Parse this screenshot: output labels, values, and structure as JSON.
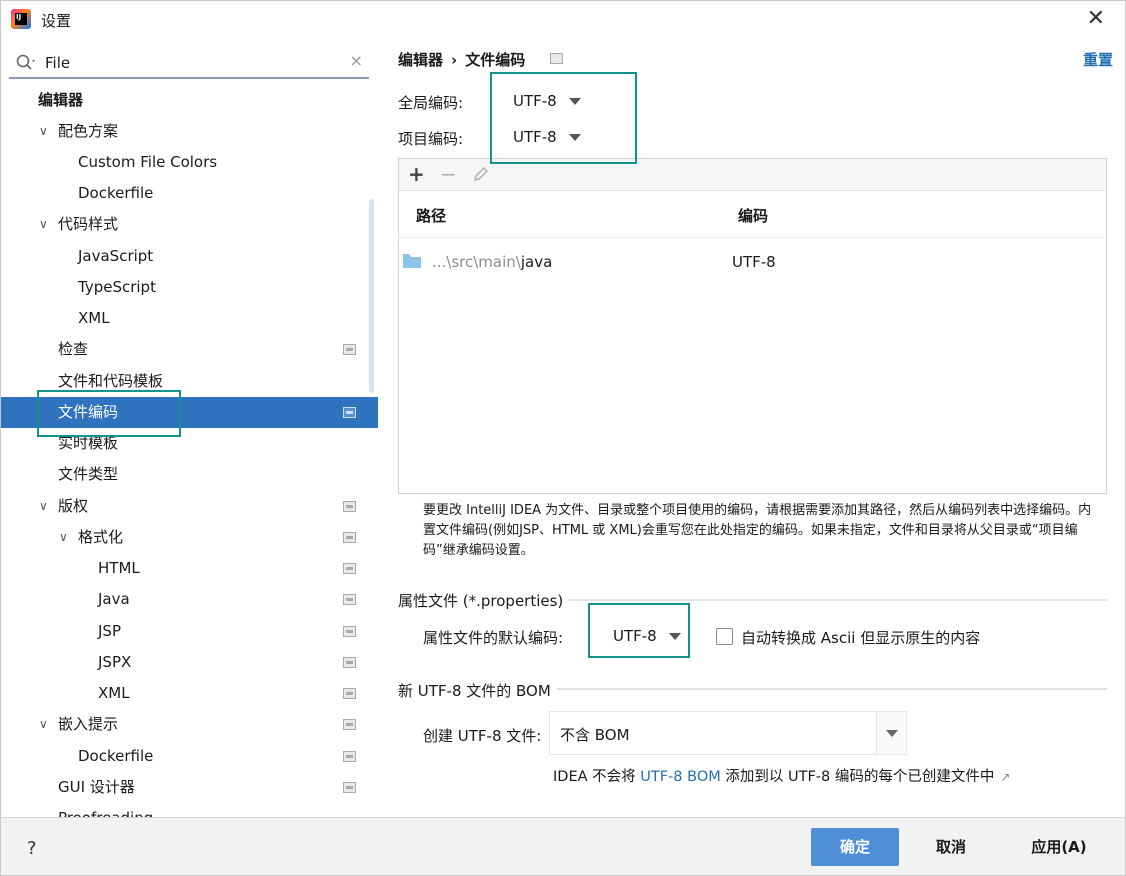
{
  "window": {
    "title": "设置",
    "close_glyph": "✕"
  },
  "search": {
    "value": "File",
    "clear_glyph": "×"
  },
  "tree": [
    {
      "label": "编辑器"
    },
    {
      "label": "配色方案",
      "chevron": "∨"
    },
    {
      "label": "Custom File Colors"
    },
    {
      "label": "Dockerfile"
    },
    {
      "label": "代码样式",
      "chevron": "∨"
    },
    {
      "label": "JavaScript"
    },
    {
      "label": "TypeScript"
    },
    {
      "label": "XML"
    },
    {
      "label": "检查"
    },
    {
      "label": "文件和代码模板"
    },
    {
      "label": "文件编码"
    },
    {
      "label": "实时模板"
    },
    {
      "label": "文件类型"
    },
    {
      "label": "版权",
      "chevron": "∨"
    },
    {
      "label": "格式化",
      "chevron": "∨"
    },
    {
      "label": "HTML"
    },
    {
      "label": "Java"
    },
    {
      "label": "JSP"
    },
    {
      "label": "JSPX"
    },
    {
      "label": "XML"
    },
    {
      "label": "嵌入提示",
      "chevron": "∨"
    },
    {
      "label": "Dockerfile"
    },
    {
      "label": "GUI 设计器"
    },
    {
      "label": "Proofreading"
    }
  ],
  "breadcrumb": {
    "parent": "编辑器",
    "sep": "›",
    "current": "文件编码"
  },
  "reset_label": "重置",
  "global_encoding": {
    "label": "全局编码:",
    "value": "UTF-8"
  },
  "project_encoding": {
    "label": "项目编码:",
    "value": "UTF-8"
  },
  "table": {
    "toolbar": {
      "add": "+",
      "remove": "−"
    },
    "headers": {
      "path": "路径",
      "encoding": "编码"
    },
    "rows": [
      {
        "path_prefix": "...\\src\\main\\",
        "path_leaf": "java",
        "encoding": "UTF-8"
      }
    ]
  },
  "hint": "要更改 IntelliJ IDEA 为文件、目录或整个项目使用的编码，请根据需要添加其路径，然后从编码列表中选择编码。内置文件编码(例如JSP、HTML 或 XML)会重写您在此处指定的编码。如果未指定，文件和目录将从父目录或“项目编码”继承编码设置。",
  "properties": {
    "section_title": "属性文件 (*.properties)",
    "default_label": "属性文件的默认编码:",
    "default_value": "UTF-8",
    "ascii_checkbox_label": "自动转换成 Ascii 但显示原生的内容"
  },
  "bom": {
    "section_title": "新 UTF-8 文件的 BOM",
    "create_label": "创建 UTF-8 文件:",
    "create_value": "不含 BOM",
    "note_before": "IDEA 不会将 ",
    "note_link": "UTF-8 BOM",
    "note_after": " 添加到以 UTF-8 编码的每个已创建文件中",
    "note_arrow": "↗"
  },
  "footer": {
    "help": "?",
    "ok": "确定",
    "cancel": "取消",
    "apply": "应用(A)"
  },
  "colors": {
    "accent": "#2f73bf",
    "highlight_box": "#12948d",
    "link": "#2470b3",
    "ok_button": "#4f8fd8"
  }
}
